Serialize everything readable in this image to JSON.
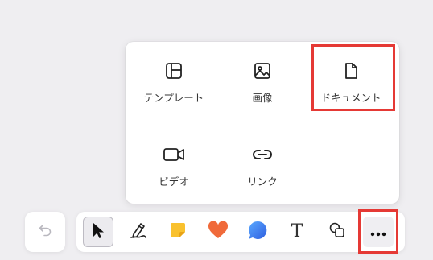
{
  "menu": {
    "items": [
      {
        "label": "テンプレート",
        "icon": "template-icon"
      },
      {
        "label": "画像",
        "icon": "image-icon"
      },
      {
        "label": "ドキュメント",
        "icon": "document-icon"
      },
      {
        "label": "ビデオ",
        "icon": "video-icon"
      },
      {
        "label": "リンク",
        "icon": "link-icon"
      }
    ]
  },
  "toolbar": {
    "undo": {
      "icon": "undo-icon"
    },
    "tools": [
      {
        "icon": "cursor-icon",
        "active": true
      },
      {
        "icon": "pen-icon"
      },
      {
        "icon": "sticky-note-icon"
      },
      {
        "icon": "heart-icon"
      },
      {
        "icon": "chat-bubble-icon"
      },
      {
        "label": "T",
        "icon": "text-icon"
      },
      {
        "icon": "shapes-icon"
      },
      {
        "icon": "more-icon"
      }
    ]
  },
  "colors": {
    "highlight": "#e53935",
    "sticky_note": "#f9c12e",
    "heart": "#f06a3a",
    "chat_bubble": "#3b7cf0"
  }
}
